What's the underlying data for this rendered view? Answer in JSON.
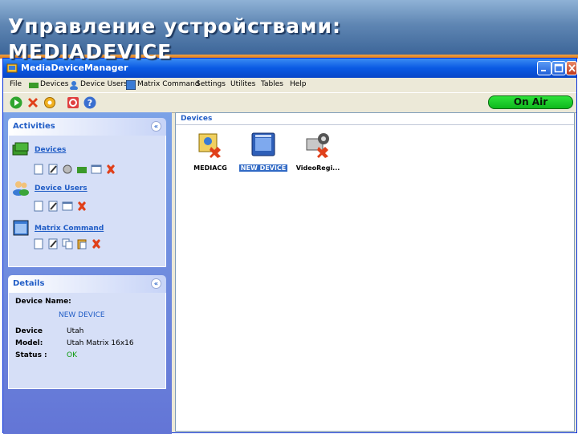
{
  "slide": {
    "title_line1": "Управление устройствами:",
    "title_line2": "MEDIADEVICE"
  },
  "window": {
    "title": "MediaDeviceManager"
  },
  "menu": [
    "File",
    "Devices",
    "Device Users",
    "Matrix Command",
    "Settings",
    "Utilites",
    "Tables",
    "Help"
  ],
  "toolbar": {
    "status": "On Air",
    "status_color": "#1fd02c"
  },
  "activities": {
    "title": "Activities",
    "collapse_glyph": "«",
    "groups": [
      {
        "label": "Devices",
        "icon": "devices-icon"
      },
      {
        "label": "Device Users",
        "icon": "users-icon"
      },
      {
        "label": "Matrix Command",
        "icon": "matrix-icon"
      }
    ]
  },
  "details": {
    "title": "Details",
    "collapse_glyph": "«",
    "device_name_label": "Device Name:",
    "device_name": "NEW DEVICE",
    "device_label": "Device",
    "device_value": "Utah",
    "model_label": "Model:",
    "model_value": "Utah Matrix 16x16",
    "status_label": "Status :",
    "status_value": "OK",
    "status_color": "#0a9a0a"
  },
  "devices": {
    "title": "Devices",
    "items": [
      {
        "label": "MEDIACG",
        "selected": false
      },
      {
        "label": "NEW DEVICE",
        "selected": true
      },
      {
        "label": "VideoRegi...",
        "selected": false
      }
    ]
  },
  "colors": {
    "accent": "#215dc6",
    "titlebar": "#0a5ae3",
    "header": "#4a74a6"
  }
}
